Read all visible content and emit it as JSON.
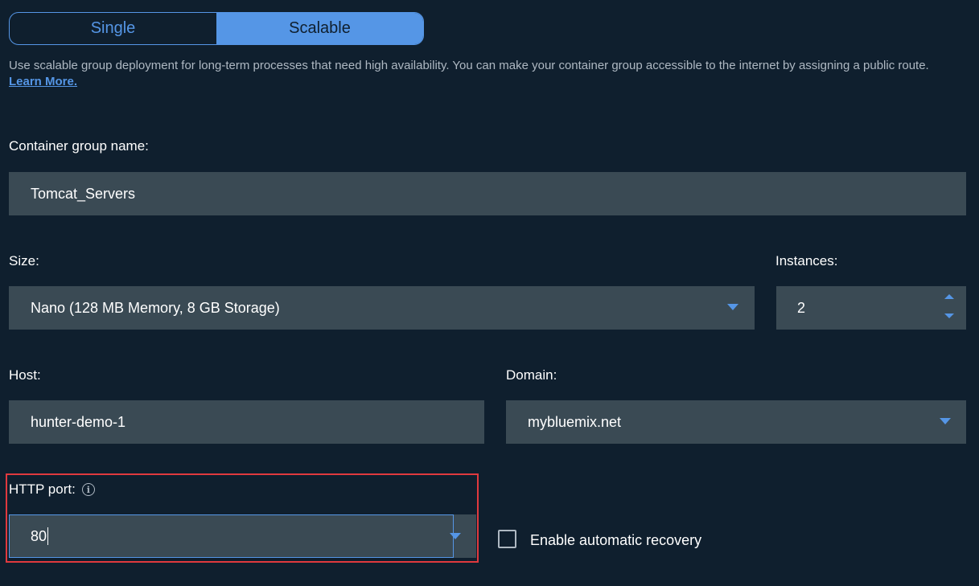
{
  "deployment_toggle": {
    "options": [
      "Single",
      "Scalable"
    ],
    "selected": "Scalable"
  },
  "description": {
    "text": "Use scalable group deployment for long-term processes that need high availability. You can make your container group accessible to the internet by assigning a public route.",
    "link": "Learn More."
  },
  "container_group_name": {
    "label": "Container group name:",
    "value": "Tomcat_Servers"
  },
  "size": {
    "label": "Size:",
    "value": "Nano (128 MB Memory, 8 GB Storage)"
  },
  "instances": {
    "label": "Instances:",
    "value": "2"
  },
  "host": {
    "label": "Host:",
    "value": "hunter-demo-1"
  },
  "domain": {
    "label": "Domain:",
    "value": "mybluemix.net"
  },
  "http_port": {
    "label": "HTTP port:",
    "value": "80",
    "info_icon": "info-icon"
  },
  "recovery": {
    "label": "Enable automatic recovery",
    "checked": false
  },
  "colors": {
    "background": "#0f1f2e",
    "accent": "#5596e6",
    "field": "#3a4a54",
    "highlight": "#e0393e"
  }
}
